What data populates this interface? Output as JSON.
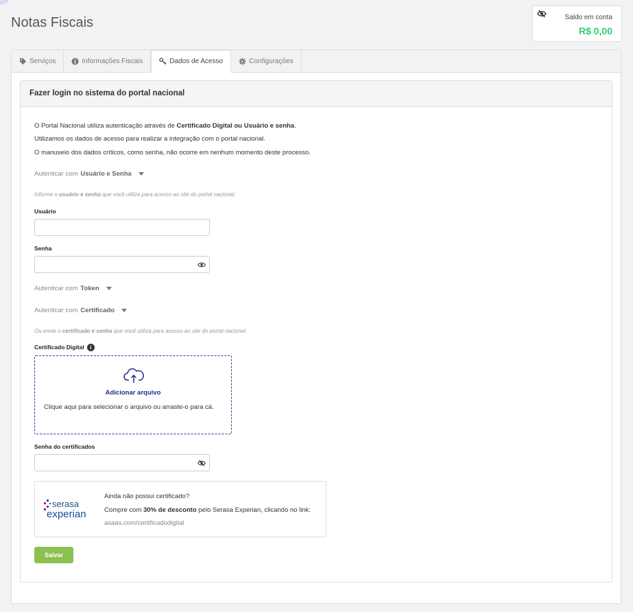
{
  "page": {
    "title": "Notas Fiscais"
  },
  "balance": {
    "label": "Saldo em conta",
    "value": "R$ 0,00"
  },
  "tabs": [
    {
      "label": "Serviços",
      "icon": "tag-icon"
    },
    {
      "label": "Informações Fiscais",
      "icon": "info-icon"
    },
    {
      "label": "Dados de Acesso",
      "icon": "key-icon",
      "active": true
    },
    {
      "label": "Configurações",
      "icon": "gear-icon"
    }
  ],
  "login": {
    "header": "Fazer login no sistema do portal nacional",
    "intro_1_pre": "O Portal Nacional utiliza autenticação através de ",
    "intro_1_bold": "Certificado Digital ou Usuário e senha",
    "intro_1_post": ".",
    "intro_2": "Utilizamos os dados de acesso para realizar a integração com o portal nacional.",
    "intro_3": "O manuseio dos dados críticos, como senha, não ocorre em nenhum momento deste processo."
  },
  "auth_user": {
    "toggle_prefix": "Autenticar com ",
    "toggle_bold": "Usuário e Senha",
    "hint_pre": "Informe o ",
    "hint_bold": "usuário e senha",
    "hint_post": " que você utiliza para acesso ao site do portal nacional.",
    "user_label": "Usuário",
    "user_value": "",
    "password_label": "Senha",
    "password_value": ""
  },
  "auth_token": {
    "toggle_prefix": "Autenticar com ",
    "toggle_bold": "Token"
  },
  "auth_cert": {
    "toggle_prefix": "Autenticar com ",
    "toggle_bold": "Certificado",
    "hint_pre": "Ou envie o ",
    "hint_bold": "certificado e senha",
    "hint_post": " que você utiliza para acesso ao site do portal nacional.",
    "cert_label": "Certificado Digital",
    "upload_title": "Adicionar arquivo",
    "upload_desc": "Clique aqui para selecionar o arquivo ou arraste-o para cá.",
    "cert_password_label": "Senha do certificados",
    "cert_password_value": ""
  },
  "serasa": {
    "question": "Ainda não possui certificado?",
    "offer_pre": "Compre com ",
    "offer_bold": "30% de desconto",
    "offer_post": " pelo Serasa Experian, clicando no link:",
    "link": "asaas.com/certificadodigital",
    "logo_line1": "serasa",
    "logo_line2": "experian"
  },
  "actions": {
    "save_label": "Salvar"
  },
  "colors": {
    "balance": "#2ecc71",
    "save": "#8cc152",
    "upload_border": "#2a3f8f",
    "serasa_blue": "#1d4f91",
    "serasa_pink": "#c1188b"
  }
}
